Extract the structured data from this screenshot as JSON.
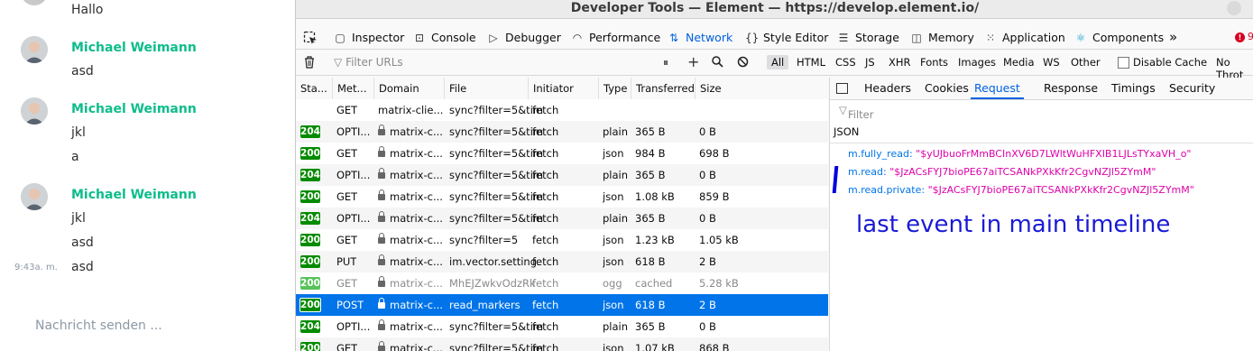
{
  "chat": {
    "messages": [
      {
        "text": "Hallo"
      },
      {
        "sender": "Michael Weimann",
        "text": "asd"
      },
      {
        "sender": "Michael Weimann",
        "text": "jkl",
        "extra": "a"
      },
      {
        "sender": "Michael Weimann",
        "text": "jkl",
        "extra": "asd",
        "extra2": "asd",
        "timestamp": "9:43a. m."
      }
    ],
    "composer_placeholder": "Nachricht senden ..."
  },
  "devtools": {
    "title": "Developer Tools — Element — https://develop.element.io/",
    "tabs": [
      {
        "label": "Inspector",
        "icon": "inspector-icon"
      },
      {
        "label": "Console",
        "icon": "console-icon"
      },
      {
        "label": "Debugger",
        "icon": "debugger-icon"
      },
      {
        "label": "Performance",
        "icon": "performance-icon"
      },
      {
        "label": "Network",
        "icon": "network-icon",
        "active": true
      },
      {
        "label": "Style Editor",
        "icon": "style-editor-icon"
      },
      {
        "label": "Storage",
        "icon": "storage-icon"
      },
      {
        "label": "Memory",
        "icon": "memory-icon"
      },
      {
        "label": "Application",
        "icon": "application-icon"
      },
      {
        "label": "Components",
        "icon": "components-icon"
      }
    ],
    "error_count": "9",
    "filter_placeholder": "Filter URLs",
    "type_filters": [
      "All",
      "HTML",
      "CSS",
      "JS",
      "XHR",
      "Fonts",
      "Images",
      "Media",
      "WS",
      "Other"
    ],
    "disable_cache": "Disable Cache",
    "throttle": "No Throt",
    "columns": [
      "Sta...",
      "Met...",
      "Domain",
      "File",
      "Initiator",
      "Type",
      "Transferred",
      "Size"
    ],
    "rows": [
      {
        "status": "",
        "method": "GET",
        "domain": "matrix-clie...",
        "file": "sync?filter=5&tim",
        "initiator": "fetch",
        "type": "",
        "transferred": "",
        "size": "",
        "lock": false
      },
      {
        "status": "204",
        "method": "OPTI...",
        "domain": "matrix-c...",
        "file": "sync?filter=5&tim",
        "initiator": "fetch",
        "type": "plain",
        "transferred": "365 B",
        "size": "0 B",
        "lock": true
      },
      {
        "status": "200",
        "method": "GET",
        "domain": "matrix-c...",
        "file": "sync?filter=5&tim",
        "initiator": "fetch",
        "type": "json",
        "transferred": "984 B",
        "size": "698 B",
        "lock": true
      },
      {
        "status": "204",
        "method": "OPTI...",
        "domain": "matrix-c...",
        "file": "sync?filter=5&tim",
        "initiator": "fetch",
        "type": "plain",
        "transferred": "365 B",
        "size": "0 B",
        "lock": true
      },
      {
        "status": "200",
        "method": "GET",
        "domain": "matrix-c...",
        "file": "sync?filter=5&tim",
        "initiator": "fetch",
        "type": "json",
        "transferred": "1.08 kB",
        "size": "859 B",
        "lock": true
      },
      {
        "status": "204",
        "method": "OPTI...",
        "domain": "matrix-c...",
        "file": "sync?filter=5&tim",
        "initiator": "fetch",
        "type": "plain",
        "transferred": "365 B",
        "size": "0 B",
        "lock": true
      },
      {
        "status": "200",
        "method": "GET",
        "domain": "matrix-c...",
        "file": "sync?filter=5",
        "initiator": "fetch",
        "type": "json",
        "transferred": "1.23 kB",
        "size": "1.05 kB",
        "lock": true
      },
      {
        "status": "200",
        "method": "PUT",
        "domain": "matrix-c...",
        "file": "im.vector.setting.",
        "initiator": "fetch",
        "type": "json",
        "transferred": "618 B",
        "size": "2 B",
        "lock": true
      },
      {
        "status": "200",
        "method": "GET",
        "domain": "matrix-c...",
        "file": "MhEJZwkvOdzRk",
        "initiator": "fetch",
        "type": "ogg",
        "transferred": "cached",
        "size": "5.28 kB",
        "lock": true,
        "muted": true
      },
      {
        "status": "200",
        "method": "POST",
        "domain": "matrix-c...",
        "file": "read_markers",
        "initiator": "fetch",
        "type": "json",
        "transferred": "618 B",
        "size": "2 B",
        "lock": true,
        "selected": true
      },
      {
        "status": "204",
        "method": "OPTI...",
        "domain": "matrix-c...",
        "file": "sync?filter=5&tim",
        "initiator": "fetch",
        "type": "plain",
        "transferred": "365 B",
        "size": "0 B",
        "lock": true
      },
      {
        "status": "200",
        "method": "GET",
        "domain": "matrix-c...",
        "file": "sync?filter=5&tim",
        "initiator": "fetch",
        "type": "json",
        "transferred": "1.07 kB",
        "size": "868 B",
        "lock": true
      }
    ],
    "side_tabs": [
      "Headers",
      "Cookies",
      "Request",
      "Response",
      "Timings",
      "Security"
    ],
    "active_side_tab": "Request",
    "param_filter_placeholder": "Filter Request Parameters",
    "json_label": "JSON",
    "json_entries": [
      {
        "key": "m.fully_read:",
        "value": "\"$yUJbuoFrMmBCInXV6D7LWltWuHFXIB1LJLsTYxaVH_o\""
      },
      {
        "key": "m.read:",
        "value": "\"$JzACsFYJ7bioPE67aiTCSANkPXkKfr2CgvNZJl5ZYmM\""
      },
      {
        "key": "m.read.private:",
        "value": "\"$JzACsFYJ7bioPE67aiTCSANkPXkKfr2CgvNZJl5ZYmM\""
      }
    ],
    "annotation": "last event in main timeline"
  }
}
